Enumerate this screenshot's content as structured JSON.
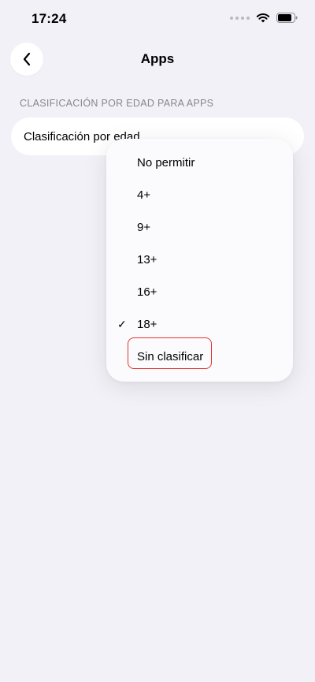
{
  "status_bar": {
    "time": "17:24"
  },
  "nav": {
    "title": "Apps",
    "back_icon": "chevron-left-icon"
  },
  "section": {
    "header": "CLASIFICACIÓN POR EDAD PARA APPS"
  },
  "row": {
    "label": "Clasificación por edad"
  },
  "menu": {
    "selected": "18+",
    "items": [
      {
        "label": "No permitir",
        "checked": false
      },
      {
        "label": "4+",
        "checked": false
      },
      {
        "label": "9+",
        "checked": false
      },
      {
        "label": "13+",
        "checked": false
      },
      {
        "label": "16+",
        "checked": false
      },
      {
        "label": "18+",
        "checked": true,
        "check_mark": "✓"
      },
      {
        "label": "Sin clasificar",
        "checked": false
      }
    ]
  },
  "colors": {
    "background": "#f2f1f7",
    "highlight_border": "#e4342c",
    "section_header": "#87878c"
  }
}
